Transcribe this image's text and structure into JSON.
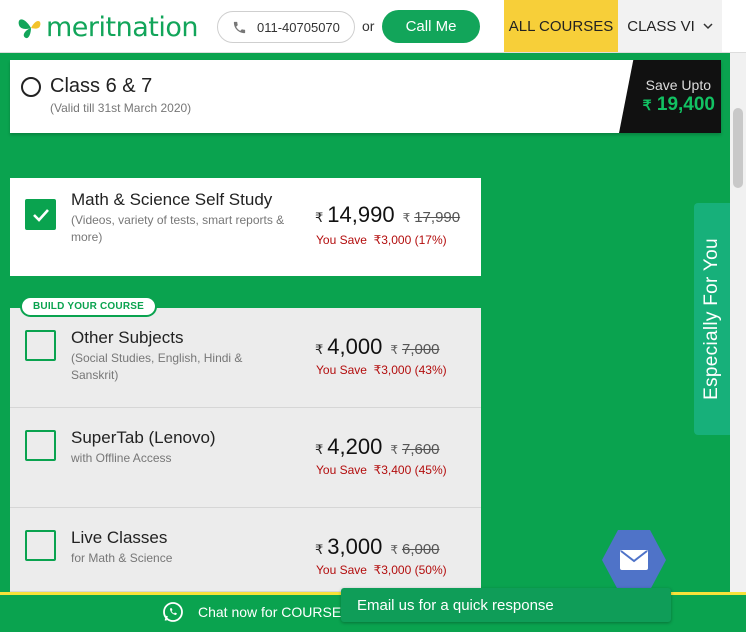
{
  "header": {
    "logo_text": "meritnation",
    "phone": "011-40705070",
    "or_label": "or",
    "call_label": "Call Me",
    "all_courses_label": "ALL COURSES",
    "class_label": "CLASS VI"
  },
  "class_option": {
    "title": "Class 6 & 7",
    "validity": "(Valid till 31st March 2020)",
    "save_label": "Save Upto",
    "save_currency": "₹",
    "save_amount": "19,400"
  },
  "build_tag": "BUILD YOUR COURSE",
  "products": [
    {
      "title": "Math & Science Self Study",
      "subtitle": "(Videos, variety of tests, smart reports & more)",
      "currency": "₹",
      "price": "14,990",
      "old_price": "17,990",
      "save_label": "You Save",
      "save_value": "₹3,000 (17%)",
      "checked": true
    },
    {
      "title": "Other Subjects",
      "subtitle": "(Social Studies, English, Hindi & Sanskrit)",
      "currency": "₹",
      "price": "4,000",
      "old_price": "7,000",
      "save_label": "You Save",
      "save_value": "₹3,000 (43%)",
      "checked": false
    },
    {
      "title": "SuperTab (Lenovo)",
      "subtitle": "with Offline Access",
      "currency": "₹",
      "price": "4,200",
      "old_price": "7,600",
      "save_label": "You Save",
      "save_value": "₹3,400 (45%)",
      "checked": false
    },
    {
      "title": "Live Classes",
      "subtitle": "for Math & Science",
      "currency": "₹",
      "price": "3,000",
      "old_price": "6,000",
      "save_label": "You Save",
      "save_value": "₹3,000 (50%)",
      "checked": false
    }
  ],
  "side_tab_label": "Especially For You",
  "chat_label": "Chat now for COURSES",
  "email_toast": "Email us for a quick response",
  "icons": [
    "phone-icon",
    "chevron-down-icon",
    "check-icon",
    "mail-icon",
    "whatsapp-icon",
    "butterfly-logo-icon"
  ],
  "colors": {
    "brand_green": "#0aa34f",
    "accent_yellow": "#f7cf39",
    "price_green": "#12c263",
    "save_red": "#b30d0d",
    "mail_blue": "#4f73c8"
  }
}
